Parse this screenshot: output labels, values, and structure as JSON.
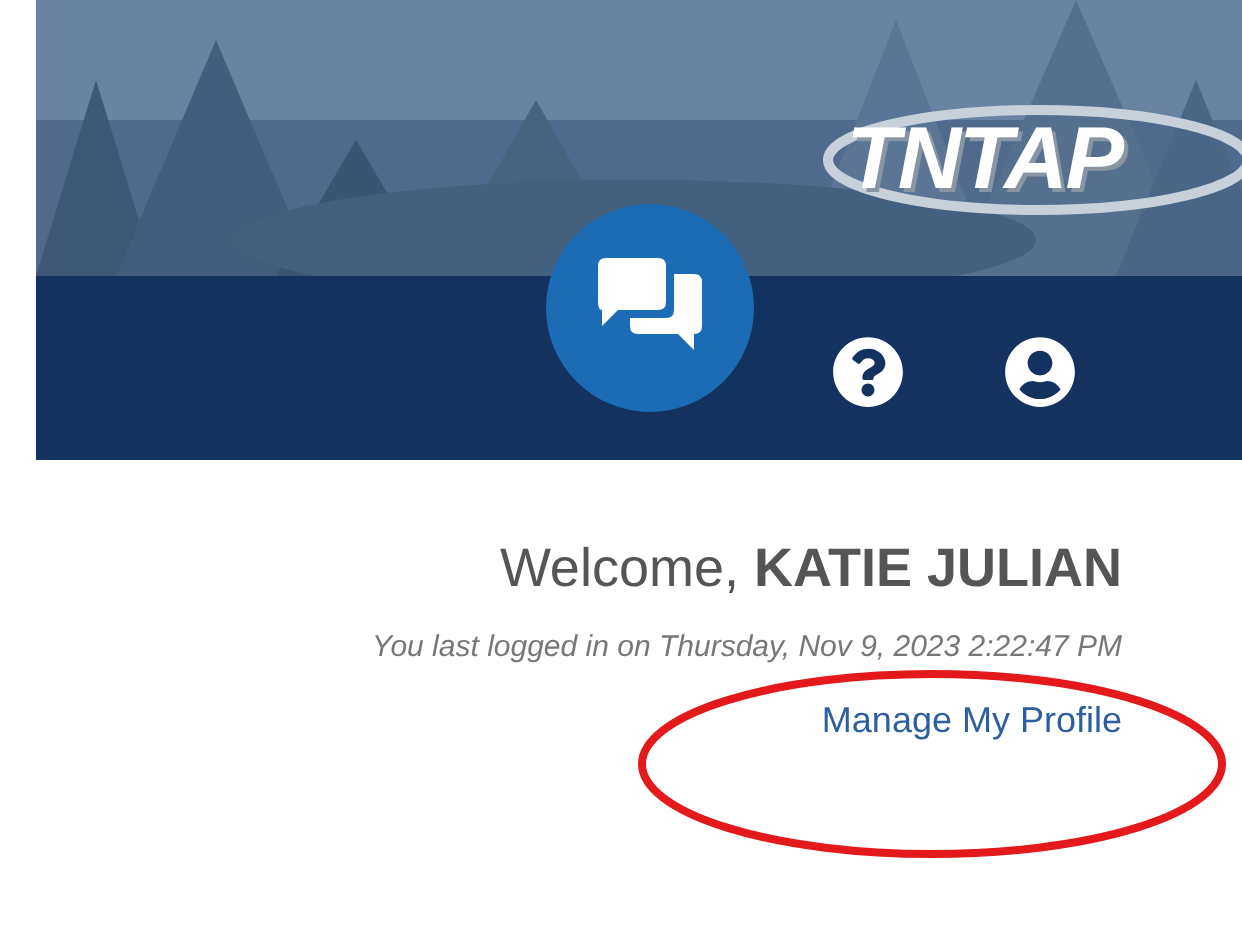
{
  "header": {
    "logo": "TNTAP"
  },
  "welcome": {
    "text": "Welcome, **KATIE JULIAN**",
    "last_login": "You last logged in on Thursday, Nov 9, 2023 2:22:47 PM",
    "profile_link": "Manage My Profile"
  },
  "annotation": {
    "kind": "ellipse",
    "color": "#e3191b"
  }
}
